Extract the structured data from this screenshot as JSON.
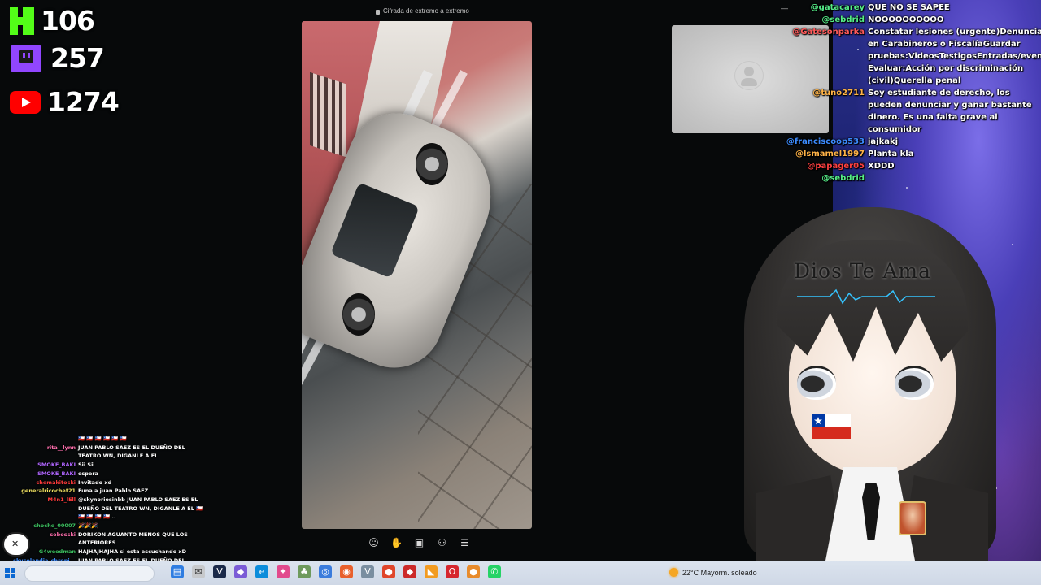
{
  "counters": {
    "kick": "106",
    "twitch": "257",
    "youtube": "1274"
  },
  "call": {
    "encryption_label": "Cifrada de extremo a extremo",
    "controls": [
      "emoji-icon",
      "hand-raise-icon",
      "screen-share-icon",
      "add-person-icon",
      "more-icon"
    ]
  },
  "overlay": {
    "vtuber_forehead_text": "Dios Te Ama"
  },
  "chat_right": [
    {
      "user": "@gatacarey",
      "color": "#55ee88",
      "text": "QUE NO SE SAPEE"
    },
    {
      "user": "@sebdrid",
      "color": "#55ee88",
      "text": "NOOOOOOOOOO"
    },
    {
      "user": "@Gatesonparka",
      "color": "#ff5a5a",
      "text": "Constatar lesiones (urgente)Denunciar en Carabineros o FiscalíaGuardar pruebas:VideosTestigosEntradas/evento Evaluar:Acción por discriminación (civil)Querella penal"
    },
    {
      "user": "@tuno2711",
      "color": "#ffb347",
      "text": "Soy estudiante de derecho, los pueden denunciar y ganar bastante dinero. Es una falta grave al consumidor"
    },
    {
      "user": "@franciscoop533",
      "color": "#3c8cff",
      "text": "jajkakj"
    },
    {
      "user": "@lsmamel1997",
      "color": "#ffb347",
      "text": "Planta kla"
    },
    {
      "user": "@papager05",
      "color": "#ff4040",
      "text": "XDDD"
    },
    {
      "user": "@sebdrid",
      "color": "#55ee88",
      "text": ""
    }
  ],
  "chat_left": [
    {
      "user": "",
      "color": "#888888",
      "text": "🇨🇱 🇨🇱 🇨🇱 🇨🇱 🇨🇱 🇨🇱"
    },
    {
      "user": "rita__lynn",
      "color": "#ff6fae",
      "text": "JUAN PABLO SAEZ ES EL DUEÑO DEL TEATRO WN, DIGANLE A EL"
    },
    {
      "user": "SMOKE_BAKI",
      "color": "#b066ff",
      "text": "Sii Sii"
    },
    {
      "user": "SMOKE_BAKI",
      "color": "#b066ff",
      "text": "espera"
    },
    {
      "user": "chemakitoski",
      "color": "#ff3b3b",
      "text": "Invitado xd"
    },
    {
      "user": "generalricochet21",
      "color": "#f5e663",
      "text": "Funa a juan Pablo SAEZ"
    },
    {
      "user": "M4n1_lEll",
      "color": "#ff3b3b",
      "text": "@skynoriosinbb JUAN PABLO SAEZ ES EL DUEÑO DEL TEATRO WN, DIGANLE A EL 🇨🇱 🇨🇱 🇨🇱 🇨🇱 🇨🇱 .."
    },
    {
      "user": "choche_00007",
      "color": "#3cc060",
      "text": "🎉🎉🎉"
    },
    {
      "user": "sebosski",
      "color": "#ff6fae",
      "text": "DORIKON AGUANTO MENOS QUE LOS ANTERIORES"
    },
    {
      "user": "G4weedman",
      "color": "#3cc060",
      "text": "HAJHAJHAJHA si esta escuchando xD"
    },
    {
      "user": "skycolandia_chroni...",
      "color": "#3c8cff",
      "text": "JUAN PABLO SAEZ ES EL DUEÑO DEL TEATRO"
    }
  ],
  "taskbar": {
    "weather_text": "22°C Mayorm. soleado"
  }
}
